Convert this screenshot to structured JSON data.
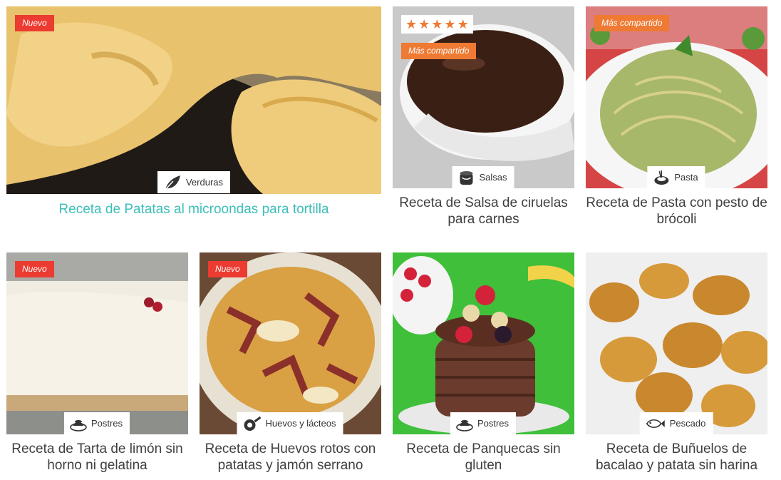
{
  "colors": {
    "accent_title": "#3dbfb8",
    "badge_nuevo": "#ec3b30",
    "badge_compartido": "#ee7a33",
    "stars": "#ee7a33"
  },
  "cards": [
    {
      "title": "Receta de Patatas al microondas para tortilla",
      "category": "Verduras",
      "category_icon": "leaf-icon",
      "badge": "Nuevo"
    },
    {
      "title": "Receta de Salsa de ciruelas para carnes",
      "category": "Salsas",
      "category_icon": "sauce-pot-icon",
      "rating": 5,
      "badge": "Más compartido"
    },
    {
      "title": "Receta de Pasta con pesto de brócoli",
      "category": "Pasta",
      "category_icon": "pasta-plate-icon",
      "badge": "Más compartido"
    },
    {
      "title": "Receta de Tarta de limón sin horno ni gelatina",
      "category": "Postres",
      "category_icon": "dessert-icon",
      "badge": "Nuevo"
    },
    {
      "title": "Receta de Huevos rotos con patatas y jamón serrano",
      "category": "Huevos y lácteos",
      "category_icon": "frying-pan-icon",
      "badge": "Nuevo"
    },
    {
      "title": "Receta de Panquecas sin gluten",
      "category": "Postres",
      "category_icon": "dessert-icon"
    },
    {
      "title": "Receta de Buñuelos de bacalao y patata sin harina",
      "category": "Pescado",
      "category_icon": "fish-icon"
    }
  ]
}
